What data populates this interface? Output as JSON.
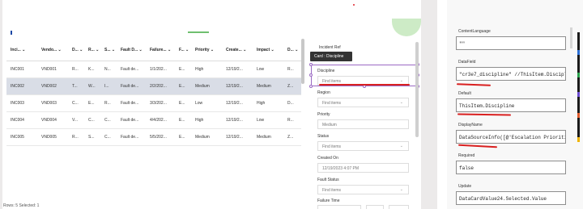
{
  "table": {
    "headers": [
      "Inci... ⌄",
      "Vendo... ⌄",
      "D... ⌄",
      "R... ⌄",
      "S... ⌄",
      "Fault D... ⌄",
      "Failure... ⌄",
      "F... ⌄",
      "Priority ⌄",
      "Create... ⌄",
      "Impact ⌄",
      "D... ⌄"
    ],
    "rows": [
      [
        "INC001",
        "VND001",
        "R...",
        "K...",
        "N...",
        "Fault de...",
        "1/1/202...",
        "E...",
        "High",
        "12/19/2...",
        "Low",
        "R..."
      ],
      [
        "INC002",
        "VND002",
        "T...",
        "W...",
        "I...",
        "Fault de...",
        "2/2/202...",
        "E...",
        "Medium",
        "12/19/2...",
        "Medium",
        "Z..."
      ],
      [
        "INC003",
        "VND003",
        "C...",
        "E...",
        "R...",
        "Fault de...",
        "3/3/202...",
        "E...",
        "Low",
        "12/19/2...",
        "High",
        "D..."
      ],
      [
        "INC004",
        "VND004",
        "V...",
        "C...",
        "C...",
        "Fault de...",
        "4/4/202...",
        "E...",
        "High",
        "12/19/2...",
        "Low",
        "R..."
      ],
      [
        "INC005",
        "VND005",
        "R...",
        "S...",
        "C...",
        "Fault de...",
        "5/5/202...",
        "E...",
        "Medium",
        "12/19/2...",
        "Medium",
        "Z..."
      ]
    ],
    "status": "Rows: 5    Selected: 1"
  },
  "form": {
    "title": "Incident Ref",
    "tooltip": "Card : Discipline",
    "discipline_label": "Discipline",
    "discipline_placeholder": "Find items",
    "region_label": "Region",
    "region_placeholder": "Find items",
    "priority_label": "Priority",
    "priority_value": "Medium",
    "status_label": "Status",
    "status_placeholder": "Find items",
    "created_label": "Created On",
    "created_value": "12/19/2023 4:07 PM",
    "fault_label": "Fault Status",
    "fault_placeholder": "Find items",
    "failure_label": "Failure Time",
    "chevron": "⌄"
  },
  "panel": {
    "content_language_label": "ContentLanguage",
    "content_language_value": "\"\"",
    "datafield_label": "DataField",
    "datafield_value": "\"cr3e7_discipline\" //ThisItem.Discipl…",
    "default_label": "Default",
    "default_value": "ThisItem.Discipline",
    "displayname_label": "DisplayName",
    "displayname_value": "DataSourceInfo([@'Escalation Prioriti…",
    "required_label": "Required",
    "required_value": "false",
    "update_label": "Update",
    "update_value": "DataCardValue24.Selected.Value"
  },
  "colors": {
    "selection": "#9b6ac4",
    "annotation_red": "#d92020",
    "accent_green": "#6fbf6f"
  }
}
